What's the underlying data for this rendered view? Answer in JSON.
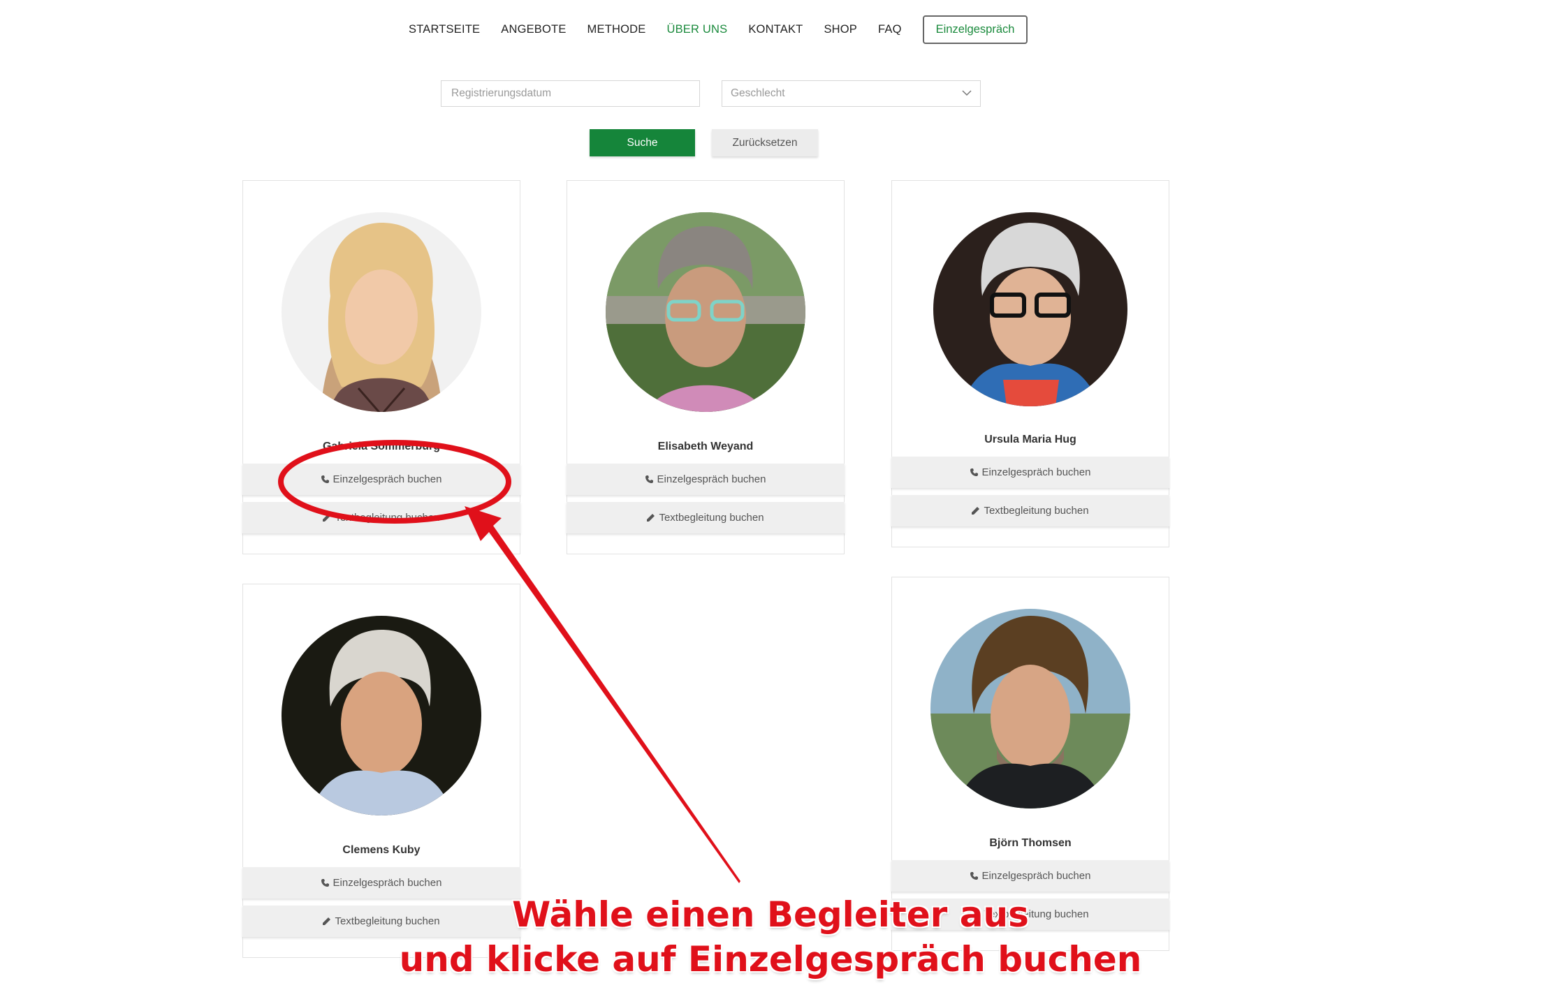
{
  "nav": {
    "items": [
      {
        "label": "STARTSEITE",
        "active": false
      },
      {
        "label": "ANGEBOTE",
        "active": false
      },
      {
        "label": "METHODE",
        "active": false
      },
      {
        "label": "ÜBER UNS",
        "active": true
      },
      {
        "label": "KONTAKT",
        "active": false
      },
      {
        "label": "SHOP",
        "active": false
      },
      {
        "label": "FAQ",
        "active": false
      }
    ],
    "cta_label": "Einzelgespräch"
  },
  "filters": {
    "date_placeholder": "Registrierungsdatum",
    "gender_selected": "Geschlecht",
    "search_label": "Suche",
    "reset_label": "Zurücksetzen"
  },
  "cards": [
    {
      "name": "Gabriela Sommerburg",
      "call_label": "Einzelgespräch buchen",
      "text_label": "Textbegleitung buchen"
    },
    {
      "name": "Elisabeth Weyand",
      "call_label": "Einzelgespräch buchen",
      "text_label": "Textbegleitung buchen"
    },
    {
      "name": "Ursula Maria Hug",
      "call_label": "Einzelgespräch buchen",
      "text_label": "Textbegleitung buchen"
    },
    {
      "name": "Clemens Kuby",
      "call_label": "Einzelgespräch buchen",
      "text_label": "Textbegleitung buchen"
    },
    {
      "name": "Björn Thomsen",
      "call_label": "Einzelgespräch buchen",
      "text_label": "Textbegleitung buchen"
    }
  ],
  "annotation": {
    "line1": "Wähle einen Begleiter aus",
    "line2": "und klicke auf Einzelgespräch buchen"
  },
  "colors": {
    "brand_green": "#15853a",
    "annotation_red": "#e0101a"
  },
  "icons": {
    "call": "phone-icon",
    "text": "pencil-icon",
    "select": "chevron-down-icon"
  }
}
